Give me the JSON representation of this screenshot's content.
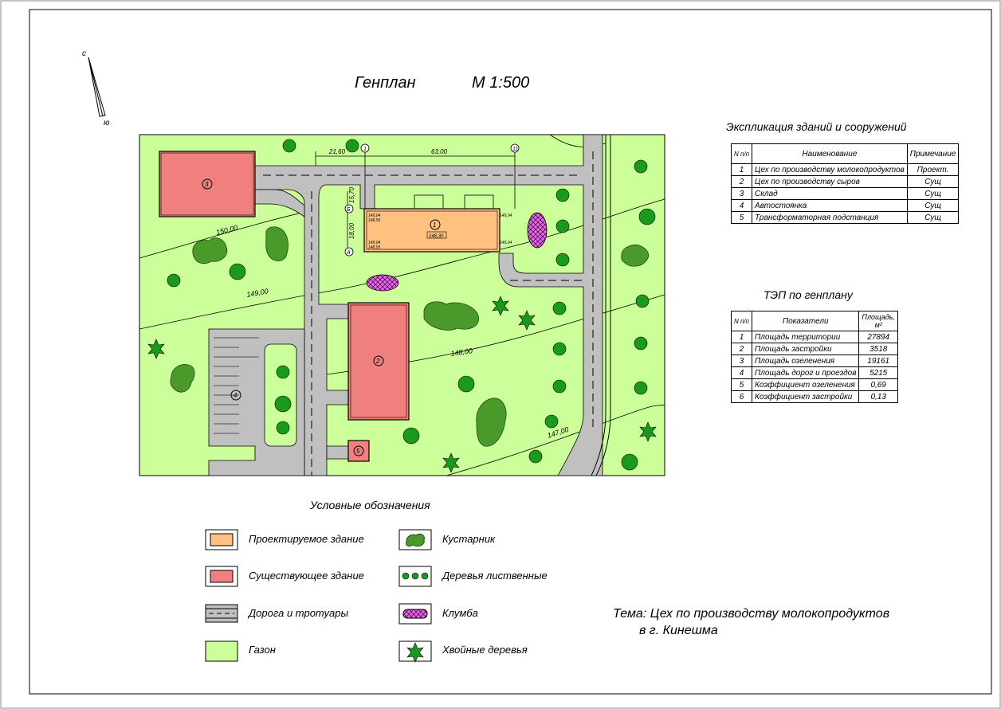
{
  "title": "Генплан",
  "scale": "М 1:500",
  "north_arrow": {
    "north": "с",
    "south": "ю"
  },
  "plan": {
    "buildings": [
      {
        "num": "1",
        "status": "projected",
        "label_mark": "148,30"
      },
      {
        "num": "2",
        "status": "existing"
      },
      {
        "num": "3",
        "status": "existing"
      },
      {
        "num": "4",
        "status": "parking"
      },
      {
        "num": "5",
        "status": "existing"
      }
    ],
    "contours": [
      "150,00",
      "149,00",
      "148,00",
      "147,00"
    ],
    "dims": [
      "21,60",
      "63,00",
      "15,70",
      "18,00"
    ],
    "axes": [
      "1",
      "11",
      "Б",
      "А"
    ],
    "elev": [
      "149,04",
      "148,55",
      "149,04",
      "148,55"
    ]
  },
  "explication": {
    "title": "Экспликация зданий и сооружений",
    "headers": [
      "N п/п",
      "Наименование",
      "Примечание"
    ],
    "rows": [
      [
        "1",
        "Цех по производству молокопродуктов",
        "Проект."
      ],
      [
        "2",
        "Цех по производству сыров",
        "Сущ"
      ],
      [
        "3",
        "Склад",
        "Сущ"
      ],
      [
        "4",
        "Автостоянка",
        "Сущ"
      ],
      [
        "5",
        "Трансформаторная подстанция",
        "Сущ"
      ]
    ]
  },
  "tep": {
    "title": "ТЭП по генплану",
    "headers": [
      "N п/п",
      "Показатели",
      "Площадь, м²"
    ],
    "rows": [
      [
        "1",
        "Площадь территории",
        "27894"
      ],
      [
        "2",
        "Площадь застройки",
        "3518"
      ],
      [
        "3",
        "Площадь озеленения",
        "19161"
      ],
      [
        "4",
        "Площадь дорог и проездов",
        "5215"
      ],
      [
        "5",
        "Коэффициент озеленения",
        "0,69"
      ],
      [
        "6",
        "Коэффициент застройки",
        "0,13"
      ]
    ]
  },
  "legend": {
    "title": "Условные обозначения",
    "items": [
      {
        "label": "Проектируемое здание"
      },
      {
        "label": "Существующее здание"
      },
      {
        "label": "Дорога и тротуары"
      },
      {
        "label": "Газон"
      },
      {
        "label": "Кустарник"
      },
      {
        "label": "Деревья лиственные"
      },
      {
        "label": "Клумба"
      },
      {
        "label": "Хвойные деревья"
      }
    ]
  },
  "theme": {
    "line1": "Тема:  Цех по производству молокопродуктов",
    "line2": "в г. Кинешма"
  },
  "colors": {
    "lawn": "#ccff99",
    "road": "#c0c0c0",
    "projected": "#ffc080",
    "existing": "#f08080",
    "tree": "#1a9a1a",
    "shrub": "#4a9a2a",
    "flowerbed": "#e060e0"
  }
}
